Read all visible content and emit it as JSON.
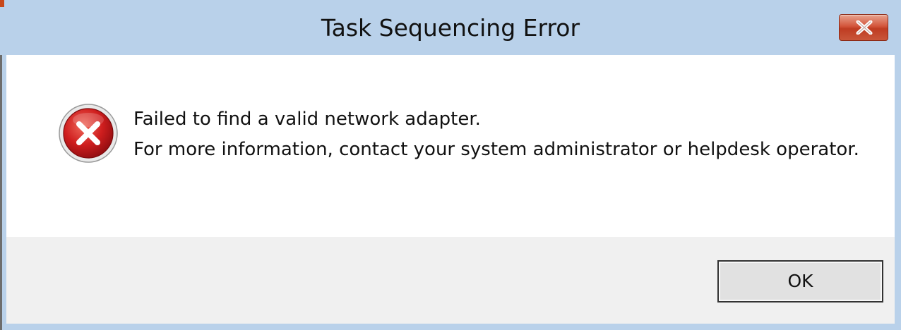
{
  "dialog": {
    "title": "Task Sequencing Error",
    "close_icon": "close-icon",
    "status_icon": "error-icon",
    "message_lines": [
      "Failed to find a valid network adapter.",
      "For more information, contact your system administrator or helpdesk operator."
    ],
    "ok_label": "OK"
  },
  "colors": {
    "title_bar": "#b9d1ea",
    "close_button": "#c94a30",
    "content_bg": "#ffffff",
    "footer_bg": "#f0f0f0",
    "error_red": "#c8181e"
  }
}
